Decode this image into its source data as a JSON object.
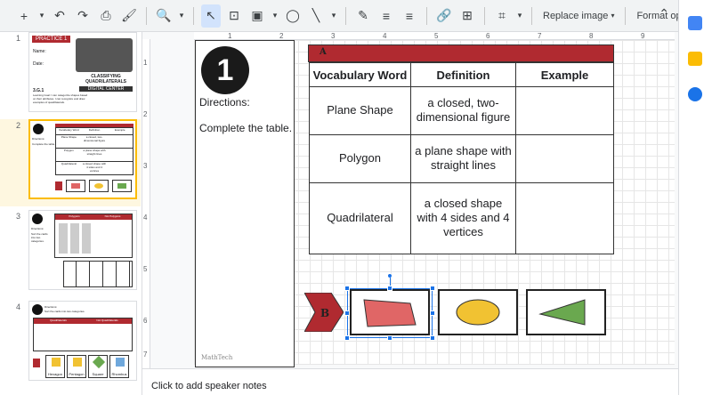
{
  "toolbar": {
    "items": [
      "+",
      "▾",
      "↶",
      "↷",
      "⎙",
      "🖌",
      "🔍",
      "▾",
      "↖",
      "⊡",
      "▣",
      "▾",
      "◯",
      "╲",
      "▾",
      "✎",
      "≡",
      "≡",
      "🔗",
      "⊞",
      "⌗",
      "▾"
    ],
    "replace_image": "Replace image",
    "replace_caret": "▾",
    "format_options": "Format options",
    "collapse": "⌃"
  },
  "filmstrip": {
    "slides": [
      {
        "num": "1",
        "title": "PRACTICE 1",
        "line1": "Name:",
        "line2": "Date:",
        "objective": "3.G.1",
        "goal": "Learning Goal: I can categorize shapes based on their attributes. I can recognize and draw examples of quadrilaterals.",
        "banner": "CLASSIFYING QUADRILATERALS",
        "banner2": "DIGITAL CENTER"
      },
      {
        "num": "2",
        "headers": [
          "Vocabulary Word",
          "Definition",
          "Example"
        ],
        "rows": [
          [
            "Plane Shape",
            "a closed, two-dimensional figure"
          ],
          [
            "Polygon",
            "a plane shape with straight lines"
          ],
          [
            "Quadrilateral",
            "a closed shape with 4 sides and 4 vertices"
          ]
        ],
        "label": "Directions:",
        "label2": "Complete the table."
      },
      {
        "num": "3",
        "headers": [
          "Polygons",
          "Not Polygons"
        ],
        "label": "Directions:",
        "label2": "Sort the cards into two categories."
      },
      {
        "num": "4",
        "headers": [
          "Quadrilaterals",
          "Not Quadrilaterals"
        ],
        "shapes": [
          "Hexagon",
          "Pentagon",
          "Square",
          "Rhombus"
        ],
        "label": "Directions:",
        "label2": "Sort the cards into two categories."
      }
    ]
  },
  "ruler": {
    "top_ticks": [
      "1",
      "2",
      "3",
      "4",
      "5",
      "6",
      "7",
      "8",
      "9"
    ],
    "left_ticks": [
      "1",
      "2",
      "3",
      "4",
      "5",
      "6",
      "7"
    ]
  },
  "slide": {
    "number": "1",
    "directions": "Directions:",
    "instruction": "Complete the table.",
    "section_a": "A",
    "section_b": "B",
    "logo": "MathTech",
    "table": {
      "headers": [
        "Vocabulary Word",
        "Definition",
        "Example"
      ],
      "rows": [
        {
          "word": "Plane Shape",
          "definition": "a closed, two-dimensional figure",
          "example": ""
        },
        {
          "word": "Polygon",
          "definition": "a plane shape with straight lines",
          "example": ""
        },
        {
          "word": "Quadrilateral",
          "definition": "a closed shape with 4 sides and 4 vertices",
          "example": ""
        }
      ]
    },
    "shapes": [
      {
        "name": "trapezoid",
        "color": "#e06666"
      },
      {
        "name": "ellipse",
        "color": "#f1c232"
      },
      {
        "name": "triangle",
        "color": "#6aa84f"
      }
    ]
  },
  "colors": {
    "banner": "#b02a30",
    "accent": "#1a73e8",
    "active_slide": "#fbbc04"
  },
  "notes": {
    "placeholder": "Click to add speaker notes"
  }
}
